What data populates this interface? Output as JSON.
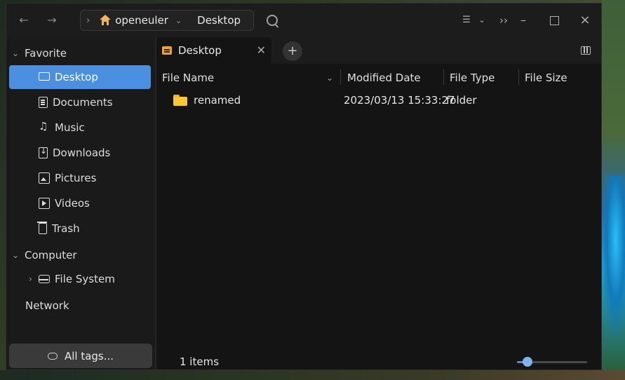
{
  "window": {
    "breadcrumb": {
      "segments": [
        "openeuler",
        "Desktop"
      ]
    }
  },
  "sidebar": {
    "groups": {
      "favorite": "Favorite",
      "computer": "Computer",
      "network": "Network"
    },
    "favorite_items": [
      {
        "label": "Desktop",
        "icon": "desktop-icon",
        "active": true
      },
      {
        "label": "Documents",
        "icon": "document-icon",
        "active": false
      },
      {
        "label": "Music",
        "icon": "music-icon",
        "active": false
      },
      {
        "label": "Downloads",
        "icon": "downloads-icon",
        "active": false
      },
      {
        "label": "Pictures",
        "icon": "pictures-icon",
        "active": false
      },
      {
        "label": "Videos",
        "icon": "videos-icon",
        "active": false
      },
      {
        "label": "Trash",
        "icon": "trash-icon",
        "active": false
      }
    ],
    "computer_items": [
      {
        "label": "File System",
        "icon": "drive-icon"
      }
    ],
    "tags_button": "All tags..."
  },
  "tabs": [
    {
      "label": "Desktop",
      "icon": "desktop-folder-icon"
    }
  ],
  "columns": {
    "name": "File Name",
    "modified": "Modified Date",
    "type": "File Type",
    "size": "File Size"
  },
  "files": [
    {
      "name": "renamed",
      "modified": "2023/03/13 15:33:27",
      "type": "folder",
      "size": "",
      "icon": "folder-icon"
    }
  ],
  "status": {
    "count": "1 items",
    "zoom_level": 0.15
  },
  "colors": {
    "accent": "#4a8fe0",
    "folder": "#f8c637",
    "tab_icon": "#f0a032",
    "home_icon": "#f0b85a"
  }
}
